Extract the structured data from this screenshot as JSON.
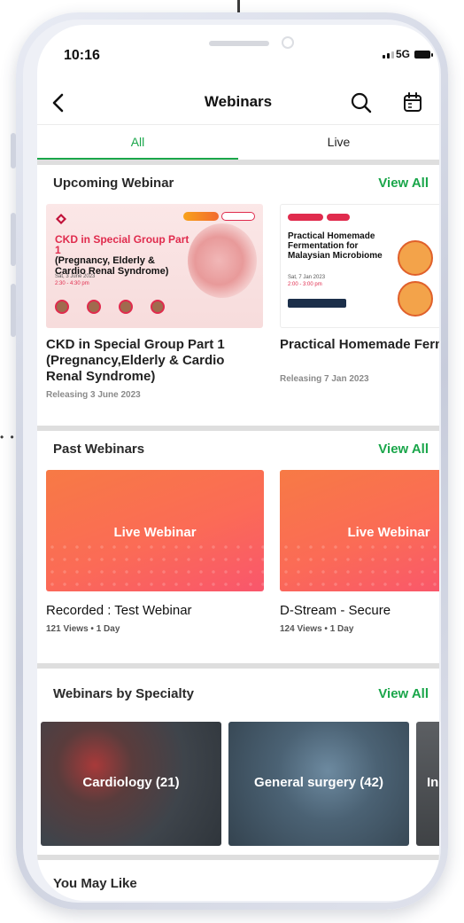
{
  "status_bar": {
    "time": "10:16",
    "network": "5G"
  },
  "header": {
    "title": "Webinars",
    "back_icon": "chevron-left-icon",
    "search_icon": "search-icon",
    "calendar_icon": "calendar-icon"
  },
  "tabs": [
    {
      "label": "All",
      "active": true
    },
    {
      "label": "Live",
      "active": false
    }
  ],
  "upcoming": {
    "title": "Upcoming Webinar",
    "view_all": "View All",
    "cards": [
      {
        "poster": {
          "title_line1": "CKD in Special Group Part 1",
          "title_line2": "(Pregnancy, Elderly &",
          "title_line3": "Cardio Renal Syndrome)",
          "date": "Sat, 3 June 2023",
          "time": "2:30 - 4:30 pm"
        },
        "title": "CKD in Special Group Part 1 (Pregnancy,Elderly & Cardio Renal Syndrome)",
        "meta": "Releasing 3 June 2023"
      },
      {
        "poster": {
          "title": "Practical Homemade Fermentation for Malaysian Microbiome",
          "date": "Sat, 7 Jan 2023",
          "time": "2:00 - 3:00 pm"
        },
        "title": "Practical Homemade Fermentation for Malaysian Microbiome",
        "meta": "Releasing 7 Jan 2023"
      }
    ]
  },
  "past": {
    "title": "Past Webinars",
    "view_all": "View All",
    "cards": [
      {
        "thumb_label": "Live Webinar",
        "title": "Recorded  : Test Webinar",
        "meta": "121 Views • 1 Day"
      },
      {
        "thumb_label": "Live Webinar",
        "title": "D-Stream - Secure",
        "meta": "124 Views • 1 Day"
      }
    ]
  },
  "specialty": {
    "title": "Webinars by Specialty",
    "view_all": "View All",
    "cards": [
      {
        "label": "Cardiology (21)"
      },
      {
        "label": "General surgery (42)"
      },
      {
        "label": "In"
      }
    ]
  },
  "may_like": {
    "title": "You May Like"
  },
  "colors": {
    "accent_green": "#1aa64a",
    "live_card_orange": "#f77a45",
    "live_card_pink": "#f9566c"
  }
}
